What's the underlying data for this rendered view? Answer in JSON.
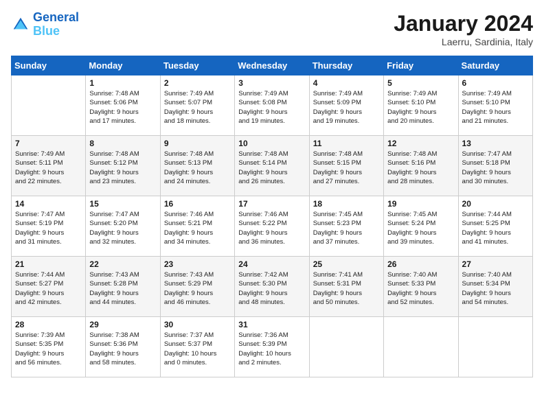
{
  "header": {
    "logo_line1": "General",
    "logo_line2": "Blue",
    "title": "January 2024",
    "subtitle": "Laerru, Sardinia, Italy"
  },
  "days_of_week": [
    "Sunday",
    "Monday",
    "Tuesday",
    "Wednesday",
    "Thursday",
    "Friday",
    "Saturday"
  ],
  "weeks": [
    [
      {
        "day": "",
        "info": ""
      },
      {
        "day": "1",
        "info": "Sunrise: 7:48 AM\nSunset: 5:06 PM\nDaylight: 9 hours\nand 17 minutes."
      },
      {
        "day": "2",
        "info": "Sunrise: 7:49 AM\nSunset: 5:07 PM\nDaylight: 9 hours\nand 18 minutes."
      },
      {
        "day": "3",
        "info": "Sunrise: 7:49 AM\nSunset: 5:08 PM\nDaylight: 9 hours\nand 19 minutes."
      },
      {
        "day": "4",
        "info": "Sunrise: 7:49 AM\nSunset: 5:09 PM\nDaylight: 9 hours\nand 19 minutes."
      },
      {
        "day": "5",
        "info": "Sunrise: 7:49 AM\nSunset: 5:10 PM\nDaylight: 9 hours\nand 20 minutes."
      },
      {
        "day": "6",
        "info": "Sunrise: 7:49 AM\nSunset: 5:10 PM\nDaylight: 9 hours\nand 21 minutes."
      }
    ],
    [
      {
        "day": "7",
        "info": "Sunrise: 7:49 AM\nSunset: 5:11 PM\nDaylight: 9 hours\nand 22 minutes."
      },
      {
        "day": "8",
        "info": "Sunrise: 7:48 AM\nSunset: 5:12 PM\nDaylight: 9 hours\nand 23 minutes."
      },
      {
        "day": "9",
        "info": "Sunrise: 7:48 AM\nSunset: 5:13 PM\nDaylight: 9 hours\nand 24 minutes."
      },
      {
        "day": "10",
        "info": "Sunrise: 7:48 AM\nSunset: 5:14 PM\nDaylight: 9 hours\nand 26 minutes."
      },
      {
        "day": "11",
        "info": "Sunrise: 7:48 AM\nSunset: 5:15 PM\nDaylight: 9 hours\nand 27 minutes."
      },
      {
        "day": "12",
        "info": "Sunrise: 7:48 AM\nSunset: 5:16 PM\nDaylight: 9 hours\nand 28 minutes."
      },
      {
        "day": "13",
        "info": "Sunrise: 7:47 AM\nSunset: 5:18 PM\nDaylight: 9 hours\nand 30 minutes."
      }
    ],
    [
      {
        "day": "14",
        "info": "Sunrise: 7:47 AM\nSunset: 5:19 PM\nDaylight: 9 hours\nand 31 minutes."
      },
      {
        "day": "15",
        "info": "Sunrise: 7:47 AM\nSunset: 5:20 PM\nDaylight: 9 hours\nand 32 minutes."
      },
      {
        "day": "16",
        "info": "Sunrise: 7:46 AM\nSunset: 5:21 PM\nDaylight: 9 hours\nand 34 minutes."
      },
      {
        "day": "17",
        "info": "Sunrise: 7:46 AM\nSunset: 5:22 PM\nDaylight: 9 hours\nand 36 minutes."
      },
      {
        "day": "18",
        "info": "Sunrise: 7:45 AM\nSunset: 5:23 PM\nDaylight: 9 hours\nand 37 minutes."
      },
      {
        "day": "19",
        "info": "Sunrise: 7:45 AM\nSunset: 5:24 PM\nDaylight: 9 hours\nand 39 minutes."
      },
      {
        "day": "20",
        "info": "Sunrise: 7:44 AM\nSunset: 5:25 PM\nDaylight: 9 hours\nand 41 minutes."
      }
    ],
    [
      {
        "day": "21",
        "info": "Sunrise: 7:44 AM\nSunset: 5:27 PM\nDaylight: 9 hours\nand 42 minutes."
      },
      {
        "day": "22",
        "info": "Sunrise: 7:43 AM\nSunset: 5:28 PM\nDaylight: 9 hours\nand 44 minutes."
      },
      {
        "day": "23",
        "info": "Sunrise: 7:43 AM\nSunset: 5:29 PM\nDaylight: 9 hours\nand 46 minutes."
      },
      {
        "day": "24",
        "info": "Sunrise: 7:42 AM\nSunset: 5:30 PM\nDaylight: 9 hours\nand 48 minutes."
      },
      {
        "day": "25",
        "info": "Sunrise: 7:41 AM\nSunset: 5:31 PM\nDaylight: 9 hours\nand 50 minutes."
      },
      {
        "day": "26",
        "info": "Sunrise: 7:40 AM\nSunset: 5:33 PM\nDaylight: 9 hours\nand 52 minutes."
      },
      {
        "day": "27",
        "info": "Sunrise: 7:40 AM\nSunset: 5:34 PM\nDaylight: 9 hours\nand 54 minutes."
      }
    ],
    [
      {
        "day": "28",
        "info": "Sunrise: 7:39 AM\nSunset: 5:35 PM\nDaylight: 9 hours\nand 56 minutes."
      },
      {
        "day": "29",
        "info": "Sunrise: 7:38 AM\nSunset: 5:36 PM\nDaylight: 9 hours\nand 58 minutes."
      },
      {
        "day": "30",
        "info": "Sunrise: 7:37 AM\nSunset: 5:37 PM\nDaylight: 10 hours\nand 0 minutes."
      },
      {
        "day": "31",
        "info": "Sunrise: 7:36 AM\nSunset: 5:39 PM\nDaylight: 10 hours\nand 2 minutes."
      },
      {
        "day": "",
        "info": ""
      },
      {
        "day": "",
        "info": ""
      },
      {
        "day": "",
        "info": ""
      }
    ]
  ]
}
